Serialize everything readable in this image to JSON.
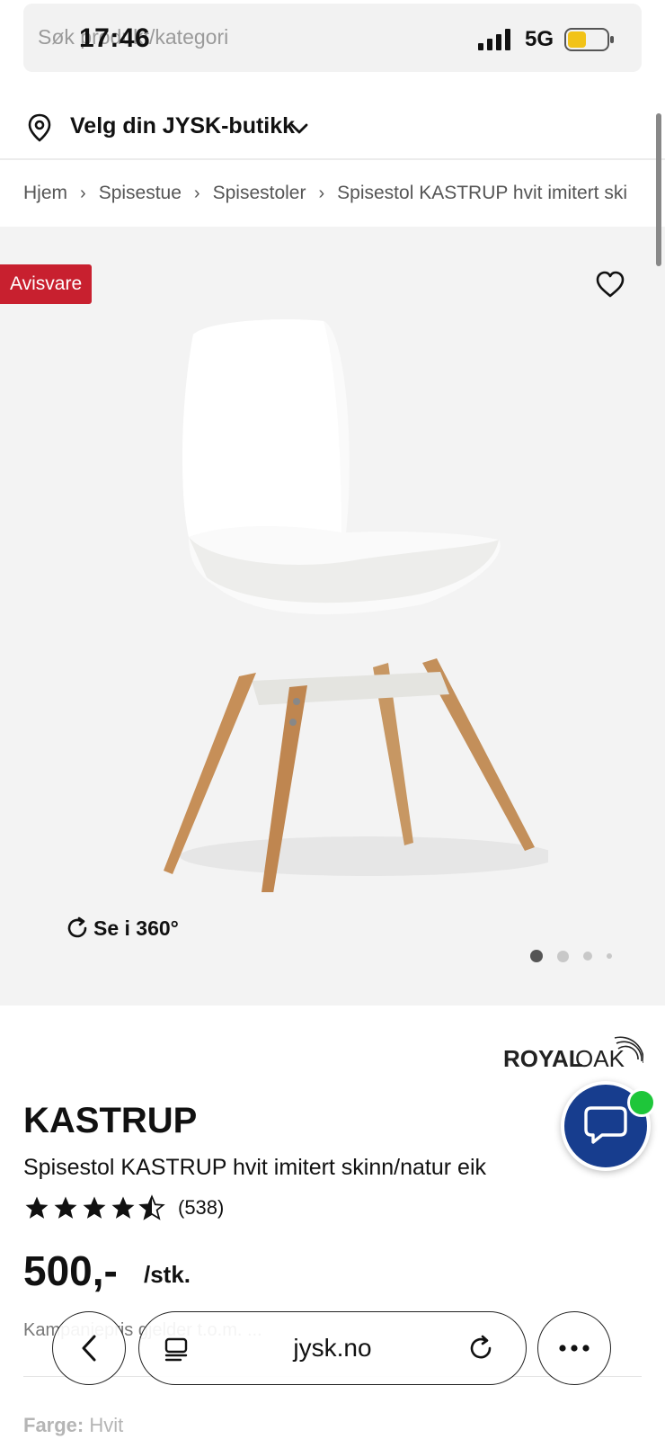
{
  "status_bar": {
    "time": "17:46",
    "network": "5G"
  },
  "search": {
    "placeholder": "Søk produkt/kategori"
  },
  "store": {
    "label": "Velg din JYSK-butikk"
  },
  "breadcrumb": [
    "Hjem",
    "Spisestue",
    "Spisestoler",
    "Spisestol KASTRUP hvit imitert ski"
  ],
  "gallery": {
    "badge": "Avisvare",
    "view360_label": "Se i 360°",
    "image_count": 4,
    "active_index": 0
  },
  "product": {
    "brand": "ROYAL OAK",
    "title": "KASTRUP",
    "subtitle": "Spisestol KASTRUP hvit imitert skinn/natur eik",
    "rating": 4.5,
    "review_count": "(538)",
    "price": "500,-",
    "price_unit": "/stk.",
    "campaign_text": "Kampanjepris gjelder t.o.m. ...",
    "color_label": "Farge:",
    "color_value": "Hvit"
  },
  "browser": {
    "url": "jysk.no"
  },
  "colors": {
    "badge": "#c8202f",
    "chat": "#173d8e",
    "online": "#1ec63a"
  }
}
